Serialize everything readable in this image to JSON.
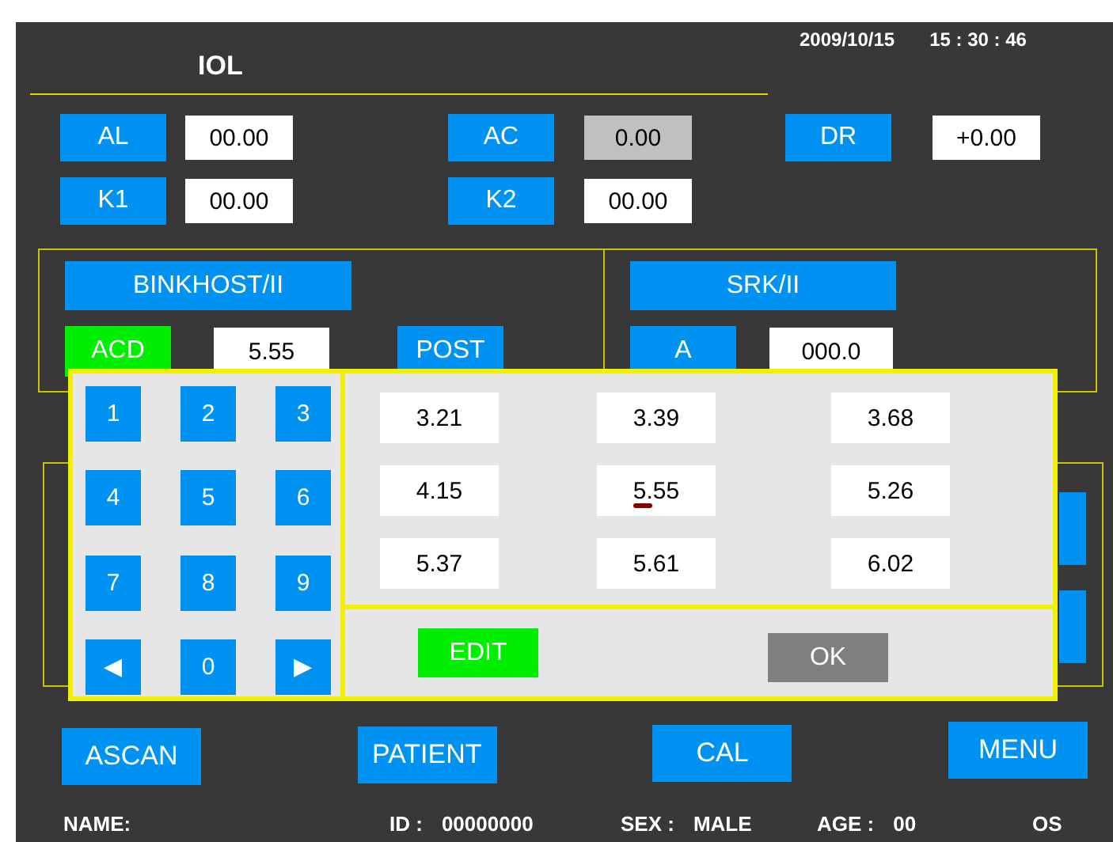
{
  "header": {
    "title": "IOL",
    "date": "2009/10/15",
    "time": "15 : 30 : 46"
  },
  "measurements": [
    [
      {
        "label": "AL",
        "value": "00.00",
        "disabled": false
      },
      {
        "label": "AC",
        "value": "0.00",
        "disabled": true
      },
      {
        "label": "DR",
        "value": "+0.00",
        "disabled": false
      }
    ],
    [
      {
        "label": "K1",
        "value": "00.00",
        "disabled": false
      },
      {
        "label": "K2",
        "value": "00.00",
        "disabled": false
      }
    ]
  ],
  "formulas": [
    {
      "name": "BINKHOST/II",
      "params": [
        {
          "kind": "param",
          "label": "ACD",
          "value": "5.55",
          "selected": true
        },
        {
          "kind": "button",
          "label": "POST"
        }
      ]
    },
    {
      "name": "SRK/II",
      "params": [
        {
          "kind": "param",
          "label": "A",
          "value": "000.0",
          "selected": false
        }
      ]
    }
  ],
  "keypad": [
    "1",
    "2",
    "3",
    "4",
    "5",
    "6",
    "7",
    "8",
    "9",
    "◀",
    "0",
    "▶"
  ],
  "values": [
    {
      "value": "3.21",
      "selected": false
    },
    {
      "value": "3.39",
      "selected": false
    },
    {
      "value": "3.68",
      "selected": false
    },
    {
      "value": "4.15",
      "selected": false
    },
    {
      "value": "5.55",
      "selected": true
    },
    {
      "value": "5.26",
      "selected": false
    },
    {
      "value": "5.37",
      "selected": false
    },
    {
      "value": "5.61",
      "selected": false
    },
    {
      "value": "6.02",
      "selected": false
    }
  ],
  "actions": [
    {
      "label": "EDIT",
      "on": true
    },
    {
      "label": "OK",
      "on": false
    }
  ],
  "nav": [
    "ASCAN",
    "PATIENT",
    "CAL",
    "MENU"
  ],
  "status": [
    {
      "label": "NAME:"
    },
    {
      "label": "ID :",
      "value": "00000000"
    },
    {
      "label": "SEX :",
      "value": "MALE"
    },
    {
      "label": "AGE :",
      "value": "00"
    },
    {
      "label": "OS"
    }
  ]
}
